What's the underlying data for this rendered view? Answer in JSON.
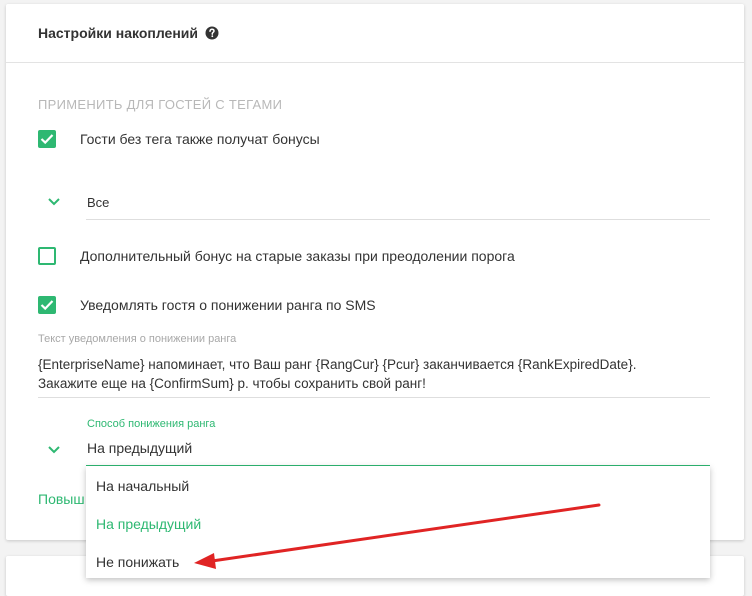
{
  "card": {
    "title": "Настройки накоплений",
    "section_label": "ПРИМЕНИТЬ ДЛЯ ГОСТЕЙ С ТЕГАМИ"
  },
  "checkboxes": {
    "no_tag_guests": {
      "label": "Гости без тега также получат бонусы",
      "checked": true
    },
    "extra_bonus": {
      "label": "Дополнительный бонус на старые заказы при преодолении порога",
      "checked": false
    },
    "notify_sms": {
      "label": "Уведомлять гостя о понижении ранга по SMS",
      "checked": true
    }
  },
  "tags_select": {
    "value": "Все"
  },
  "notification_text": {
    "label": "Текст уведомления о понижении ранга",
    "value": "{EnterpriseName} напоминает, что Ваш ранг {RangCur} {Pcur} заканчивается {RankExpiredDate}. Закажите еще на {ConfirmSum} р. чтобы сохранить свой ранг!"
  },
  "rank_method": {
    "label": "Способ понижения ранга",
    "value": "На предыдущий",
    "options": [
      "На начальный",
      "На предыдущий",
      "Не понижать"
    ],
    "selected_index": 1
  },
  "cut_link": {
    "text": "Повыш"
  },
  "colors": {
    "accent": "#2eb872",
    "annotation_arrow": "#e02424"
  },
  "icons": {
    "help": "question-circle-icon",
    "checkbox": "checkmark-icon",
    "select": "chevron-down-icon"
  }
}
